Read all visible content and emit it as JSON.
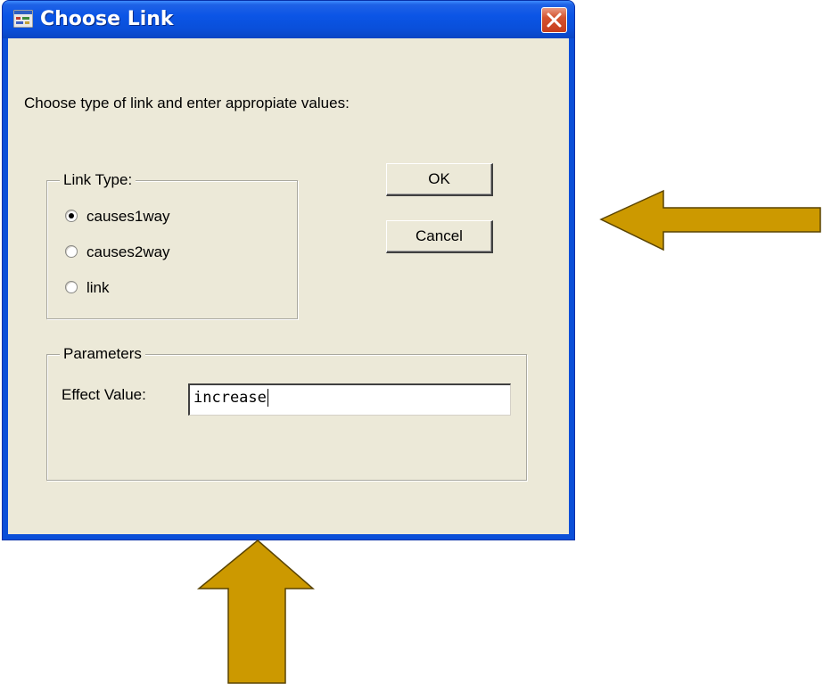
{
  "window": {
    "title": "Choose Link"
  },
  "instruction": "Choose type of link and enter appropiate values:",
  "link_type": {
    "legend": "Link Type:",
    "options": [
      {
        "label": "causes1way",
        "checked": true
      },
      {
        "label": "causes2way",
        "checked": false
      },
      {
        "label": "link",
        "checked": false
      }
    ]
  },
  "buttons": {
    "ok": "OK",
    "cancel": "Cancel"
  },
  "parameters": {
    "legend": "Parameters",
    "effect_label": "Effect Value:",
    "effect_value": "increase"
  },
  "annotation_arrow_color": "#cc9900"
}
